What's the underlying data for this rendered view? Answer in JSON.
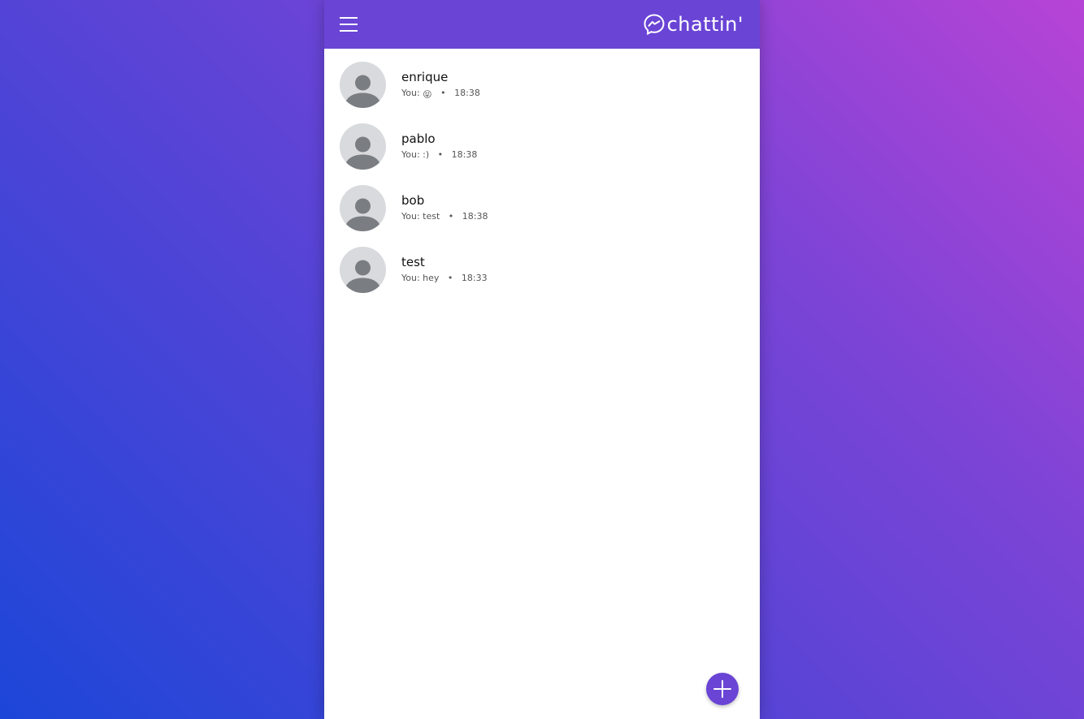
{
  "header": {
    "menu_icon": "hamburger-menu-icon",
    "brand_icon": "chat-bubble-logo-icon",
    "brand_name": "chattin'",
    "accent_color": "#6a44d5"
  },
  "conversations": [
    {
      "name": "enrique",
      "prefix": "You:",
      "last_message": "😝",
      "time": "18:38"
    },
    {
      "name": "pablo",
      "prefix": "You:",
      "last_message": ":)",
      "time": "18:38"
    },
    {
      "name": "bob",
      "prefix": "You:",
      "last_message": "test",
      "time": "18:38"
    },
    {
      "name": "test",
      "prefix": "You:",
      "last_message": "hey",
      "time": "18:33"
    }
  ],
  "fab": {
    "icon": "plus-icon"
  },
  "separator": "•"
}
